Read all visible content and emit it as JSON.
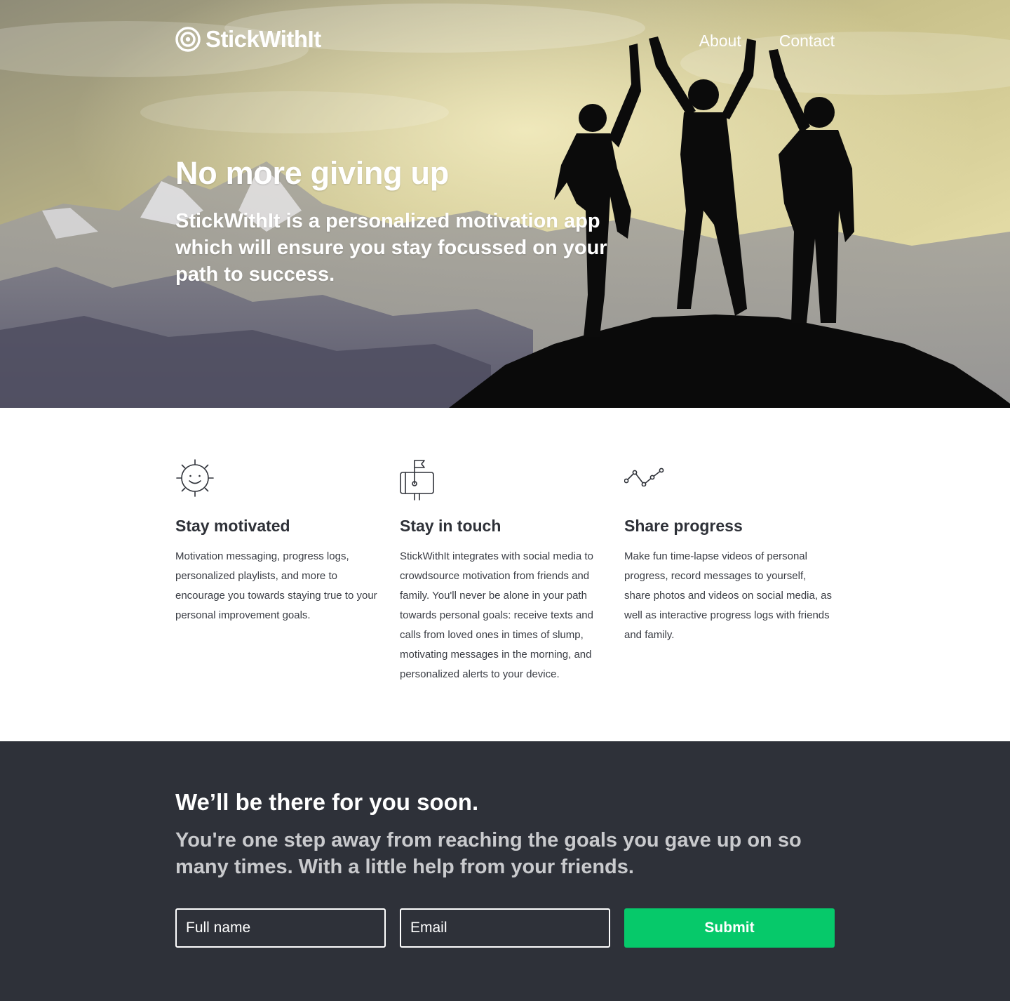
{
  "header": {
    "logo_text": "StickWithIt",
    "nav": [
      {
        "label": "About"
      },
      {
        "label": "Contact"
      }
    ]
  },
  "hero": {
    "title": "No more giving up",
    "subtitle": "StickWithIt is a personalized motivation app which will ensure you stay focussed on your path to success."
  },
  "features": [
    {
      "icon": "smiley-sun-icon",
      "title": "Stay motivated",
      "text": "Motivation messaging, progress logs, personalized playlists, and more to encourage you towards staying true to your personal improvement goals."
    },
    {
      "icon": "mailbox-flag-icon",
      "title": "Stay in touch",
      "text": "StickWithIt integrates with social media to crowdsource motivation from friends and family. You'll never be alone in your path towards personal goals: receive texts and calls from loved ones in times of slump, motivating messages in the morning, and personalized alerts to your device."
    },
    {
      "icon": "line-graph-icon",
      "title": "Share progress",
      "text": "Make fun time-lapse videos of personal progress, record messages to yourself, share photos and videos on social media, as well as interactive progress logs with friends and family."
    }
  ],
  "cta": {
    "title": "We’ll be there for you soon.",
    "subtitle": "You're one step away from reaching the goals you gave up on so many times. With a little help from your friends.",
    "name_placeholder": "Full name",
    "email_placeholder": "Email",
    "submit_label": "Submit"
  },
  "colors": {
    "accent": "#06c96a",
    "dark_background": "#2e3139",
    "text_dark": "#2e3138",
    "cta_subtitle": "#c9cacd"
  }
}
